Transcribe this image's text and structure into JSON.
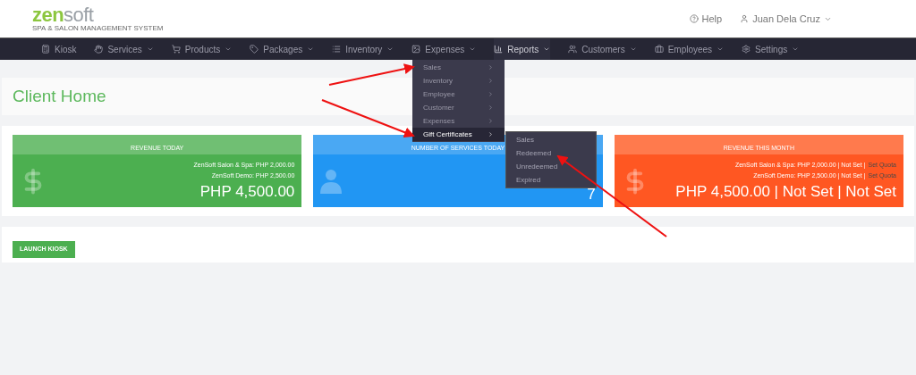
{
  "header": {
    "logo_main": "zen",
    "logo_rest": "soft",
    "logo_tagline": "SPA & SALON MANAGEMENT SYSTEM",
    "help": "Help",
    "user": "Juan Dela Cruz"
  },
  "nav": [
    {
      "label": "Kiosk",
      "dropdown": false,
      "expanded": false
    },
    {
      "label": "Services",
      "dropdown": true,
      "expanded": false
    },
    {
      "label": "Products",
      "dropdown": true,
      "expanded": false
    },
    {
      "label": "Packages",
      "dropdown": true,
      "expanded": false
    },
    {
      "label": "Inventory",
      "dropdown": true,
      "expanded": false
    },
    {
      "label": "Expenses",
      "dropdown": true,
      "expanded": false
    },
    {
      "label": "Reports",
      "dropdown": true,
      "expanded": true
    },
    {
      "label": "Customers",
      "dropdown": true,
      "expanded": false
    },
    {
      "label": "Employees",
      "dropdown": true,
      "expanded": false
    },
    {
      "label": "Settings",
      "dropdown": true,
      "expanded": false
    }
  ],
  "reports_menu": [
    {
      "label": "Sales",
      "selected": false
    },
    {
      "label": "Inventory",
      "selected": false
    },
    {
      "label": "Employee",
      "selected": false
    },
    {
      "label": "Customer",
      "selected": false
    },
    {
      "label": "Expenses",
      "selected": false
    },
    {
      "label": "Gift Certificates",
      "selected": true
    }
  ],
  "submenu": [
    "Sales",
    "Redeemed",
    "Unredeemed",
    "Expired"
  ],
  "page_title": "Client Home",
  "cards": [
    {
      "kind": "revenue",
      "title": "REVENUE TODAY",
      "color": "#4caf50",
      "lines": [
        {
          "text": "ZenSoft Salon & Spa: PHP 2,000.00"
        },
        {
          "text": "ZenSoft Demo: PHP 2,500.00"
        }
      ],
      "total": "PHP 4,500.00"
    },
    {
      "kind": "count",
      "title": "NUMBER OF SERVICES TODAY",
      "color": "#2196f3",
      "total": "7"
    },
    {
      "kind": "revenue",
      "title": "REVENUE THIS MONTH",
      "color": "#ff5722",
      "lines": [
        {
          "text": "ZenSoft Salon & Spa: PHP 2,000.00 | Not Set |",
          "link": "Set Quota"
        },
        {
          "text": "ZenSoft Demo: PHP 2,500.00 | Not Set |",
          "link": "Set Quota"
        }
      ],
      "total": "PHP 4,500.00 | Not Set | Not Set"
    }
  ],
  "launch_button": "LAUNCH KIOSK"
}
